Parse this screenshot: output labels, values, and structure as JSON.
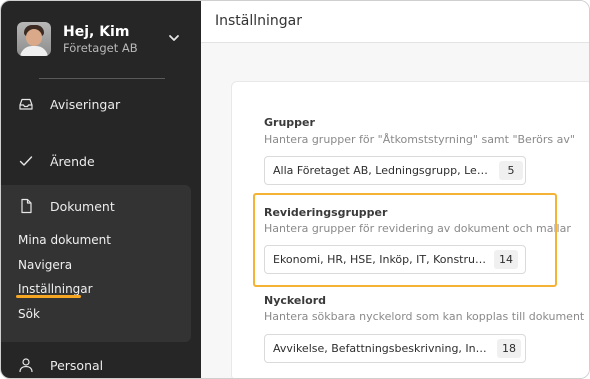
{
  "profile": {
    "greeting": "Hej, Kim",
    "company": "Företaget AB",
    "avatar_icon": "user-photo"
  },
  "sidebar": {
    "items": [
      {
        "label": "Aviseringar",
        "icon": "inbox-icon"
      },
      {
        "label": "Ärende",
        "icon": "check-icon"
      },
      {
        "label": "Dokument",
        "icon": "document-icon"
      },
      {
        "label": "Personal",
        "icon": "person-icon"
      }
    ],
    "document_subitems": [
      {
        "label": "Mina dokument"
      },
      {
        "label": "Navigera"
      },
      {
        "label": "Inställningar",
        "active": true
      },
      {
        "label": "Sök"
      }
    ]
  },
  "header": {
    "title": "Inställningar"
  },
  "sections": [
    {
      "title": "Grupper",
      "description": "Hantera grupper för \"Åtkomststyrning\" samt \"Berörs av\"",
      "value": "Alla Företaget AB, Ledningsgrupp, Leverantörer",
      "count": "5"
    },
    {
      "title": "Revideringsgrupper",
      "description": "Hantera grupper för revidering av dokument och mallar",
      "value": "Ekonomi, HR, HSE, Inköp, IT, Konstruktion, Kvalitet",
      "count": "14"
    },
    {
      "title": "Nyckelord",
      "description": "Hantera sökbara nyckelord som kan kopplas till dokument",
      "value": "Avvikelse, Befattningsbeskrivning, Inköp, IT, Kvalitet",
      "count": "18"
    }
  ],
  "colors": {
    "sidebar_bg": "#262626",
    "accent": "#f5a623",
    "highlight": "#f5b335"
  }
}
